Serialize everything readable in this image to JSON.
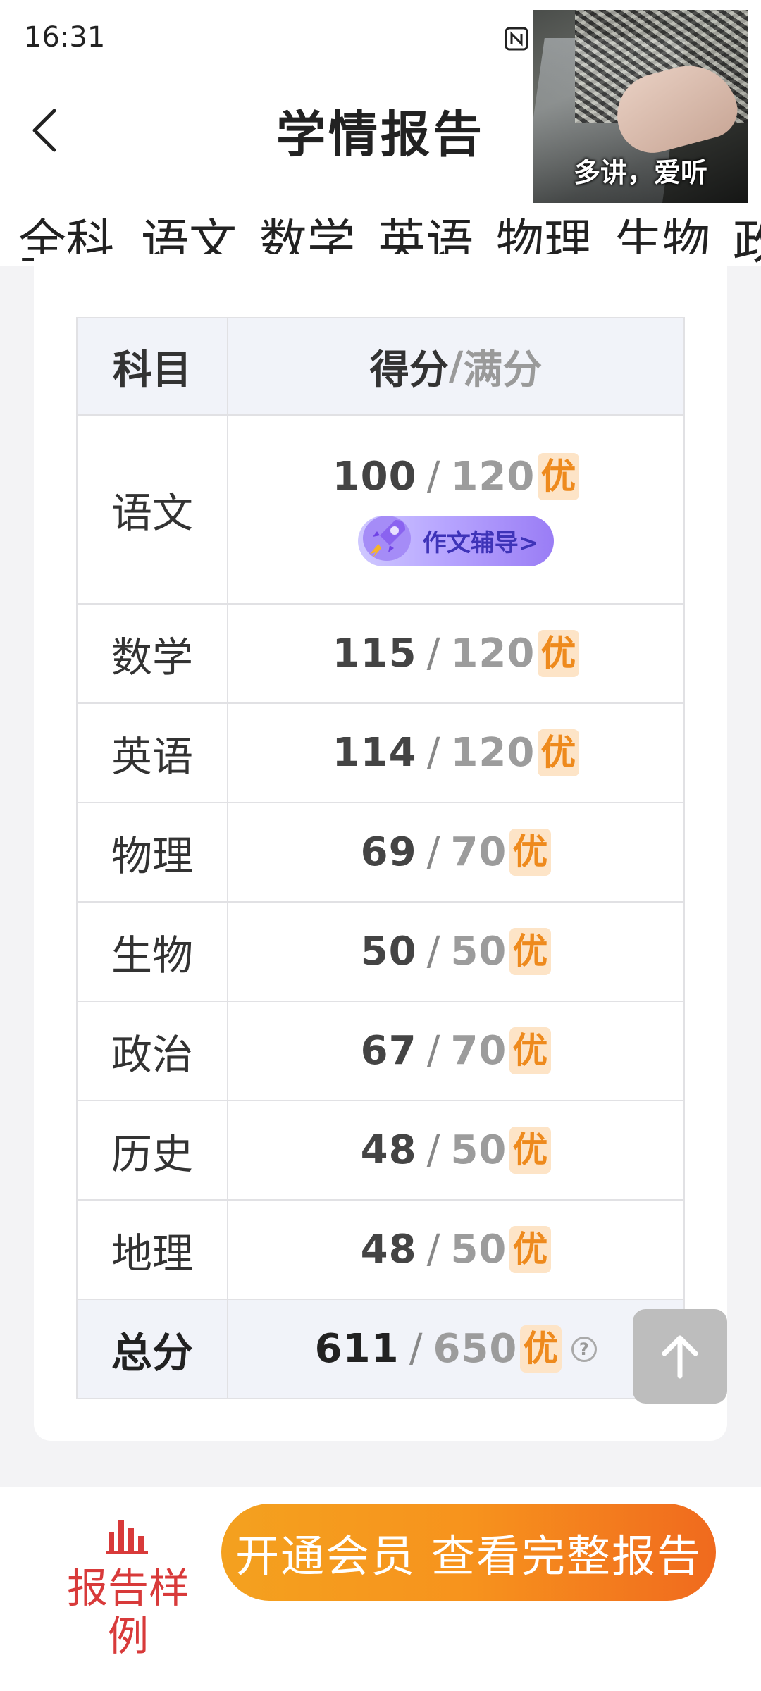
{
  "status_bar": {
    "time": "16:31"
  },
  "header": {
    "title": "学情报告",
    "back_icon": "chevron-left-icon"
  },
  "tabs": [
    "全科",
    "语文",
    "数学",
    "英语",
    "物理",
    "生物",
    "政"
  ],
  "active_tab_index": 0,
  "video_overlay": {
    "caption": "多讲，爱听"
  },
  "table": {
    "header_subject": "科目",
    "header_score": "得分",
    "header_sep": "/",
    "header_full": "满分",
    "essay_button_label": "作文辅导>",
    "rows": [
      {
        "subject": "语文",
        "score": "100",
        "full": "120",
        "grade": "优"
      },
      {
        "subject": "数学",
        "score": "115",
        "full": "120",
        "grade": "优"
      },
      {
        "subject": "英语",
        "score": "114",
        "full": "120",
        "grade": "优"
      },
      {
        "subject": "物理",
        "score": "69",
        "full": "70",
        "grade": "优"
      },
      {
        "subject": "生物",
        "score": "50",
        "full": "50",
        "grade": "优"
      },
      {
        "subject": "政治",
        "score": "67",
        "full": "70",
        "grade": "优"
      },
      {
        "subject": "历史",
        "score": "48",
        "full": "50",
        "grade": "优"
      },
      {
        "subject": "地理",
        "score": "48",
        "full": "50",
        "grade": "优"
      }
    ],
    "total": {
      "subject": "总分",
      "score": "611",
      "full": "650",
      "grade": "优",
      "help": "?"
    },
    "slash": "/"
  },
  "bottom_bar": {
    "sample_label": "报告样例",
    "vip_button": "开通会员 查看完整报告"
  },
  "colors": {
    "accent_red": "#d83a3a",
    "grade_bg": "#fde4c7",
    "grade_text": "#ee8a1d",
    "cta_orange": "#f7931d",
    "header_row_bg": "#f1f3f9"
  }
}
